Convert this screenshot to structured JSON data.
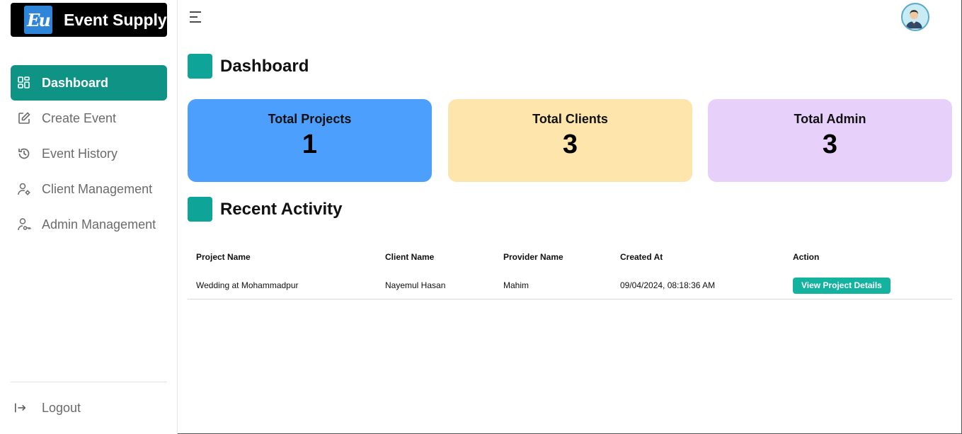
{
  "brand": {
    "logo_text": "Eu",
    "name": "Event Supply"
  },
  "sidebar": {
    "items": [
      {
        "label": "Dashboard",
        "icon": "dashboard-grid-icon",
        "active": true
      },
      {
        "label": "Create Event",
        "icon": "edit-icon"
      },
      {
        "label": "Event History",
        "icon": "history-icon"
      },
      {
        "label": "Client Management",
        "icon": "user-settings-icon"
      },
      {
        "label": "Admin Management",
        "icon": "user-key-icon"
      }
    ],
    "logout_label": "Logout"
  },
  "dashboard": {
    "title": "Dashboard",
    "cards": [
      {
        "label": "Total Projects",
        "value": "1",
        "color": "#4d9ffd"
      },
      {
        "label": "Total Clients",
        "value": "3",
        "color": "#fde5ac"
      },
      {
        "label": "Total Admin",
        "value": "3",
        "color": "#e7d1fb"
      }
    ]
  },
  "recent": {
    "title": "Recent Activity",
    "headers": [
      "Project Name",
      "Client Name",
      "Provider Name",
      "Created At",
      "Action"
    ],
    "rows": [
      {
        "project": "Wedding at Mohammadpur",
        "client": "Nayemul Hasan",
        "provider": "Mahim",
        "created": "09/04/2024, 08:18:36 AM",
        "action": "View Project Details"
      }
    ]
  },
  "colors": {
    "accent": "#0e9385",
    "button": "#14b3a0"
  }
}
